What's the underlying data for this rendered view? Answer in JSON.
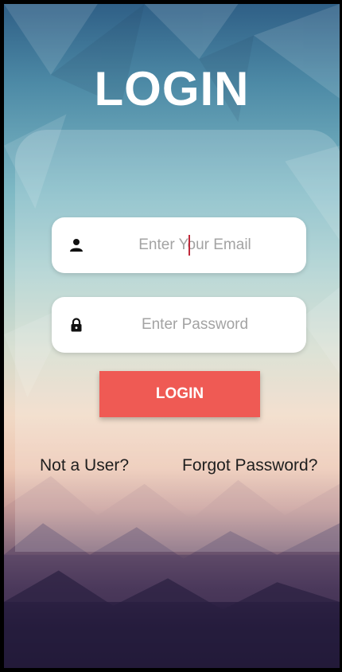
{
  "header": {
    "title": "LOGIN"
  },
  "form": {
    "email": {
      "placeholder": "Enter Your Email",
      "icon": "person-icon"
    },
    "password": {
      "placeholder": "Enter Password",
      "icon": "lock-icon"
    },
    "submit_label": "LOGIN"
  },
  "links": {
    "not_user": "Not a User?",
    "forgot_password": "Forgot Password?"
  },
  "colors": {
    "button": "#ef5a54",
    "title": "#ffffff",
    "field_bg": "#ffffff"
  }
}
